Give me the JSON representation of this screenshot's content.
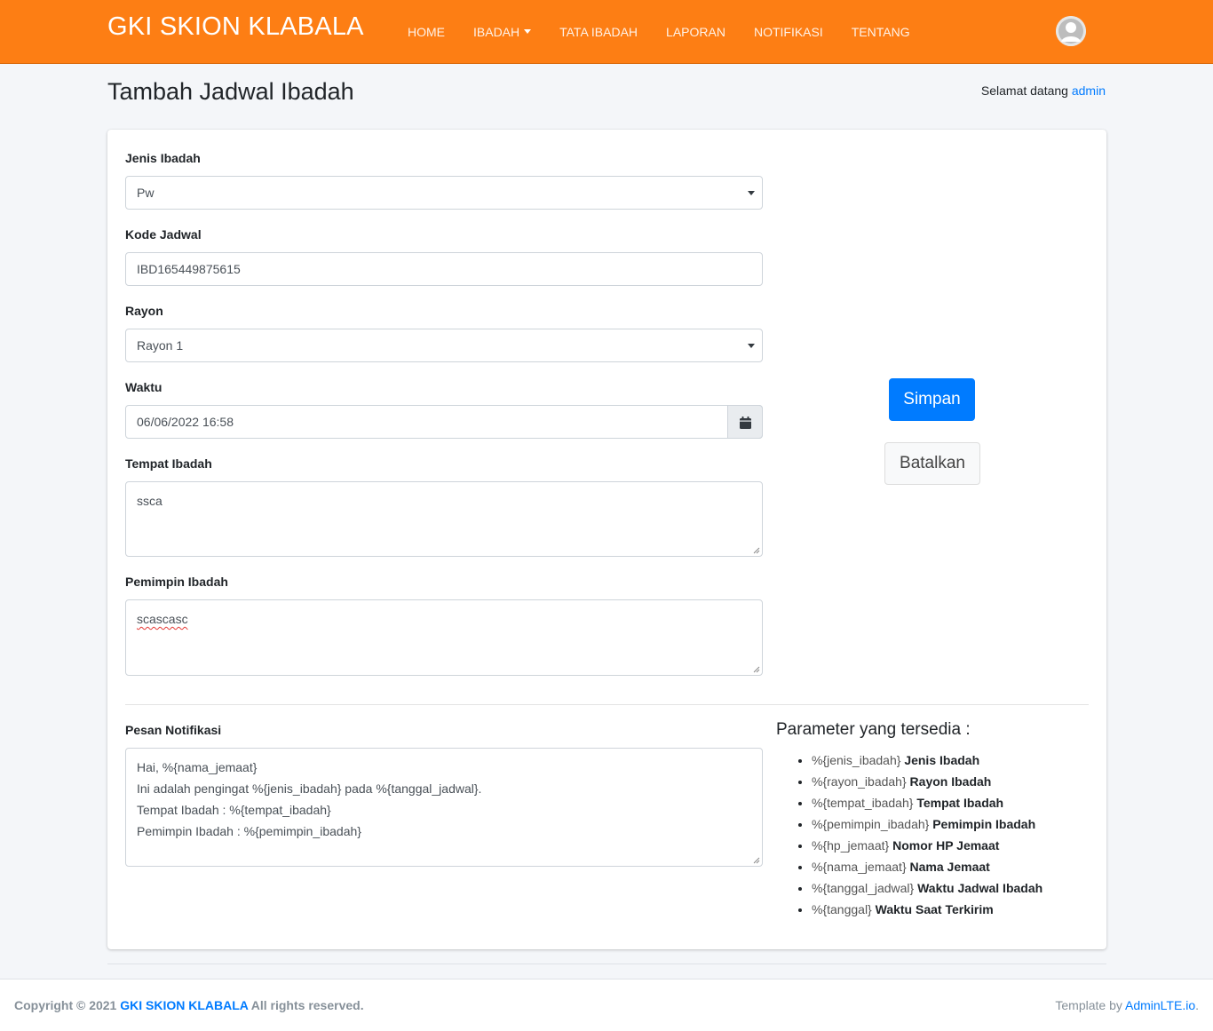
{
  "navbar": {
    "brand": "GKI SKION KLABALA",
    "items": [
      {
        "label": "HOME"
      },
      {
        "label": "IBADAH"
      },
      {
        "label": "TATA IBADAH"
      },
      {
        "label": "LAPORAN"
      },
      {
        "label": "NOTIFIKASI"
      },
      {
        "label": "TENTANG"
      }
    ],
    "avatar_icon": "user-avatar-icon"
  },
  "header": {
    "title": "Tambah Jadwal Ibadah",
    "welcome_prefix": "Selamat datang",
    "welcome_user": "admin"
  },
  "form": {
    "jenis_ibadah": {
      "label": "Jenis Ibadah",
      "value": "Pw"
    },
    "kode_jadwal": {
      "label": "Kode Jadwal",
      "value": "IBD165449875615"
    },
    "rayon": {
      "label": "Rayon",
      "value": "Rayon 1"
    },
    "waktu": {
      "label": "Waktu",
      "value": "06/06/2022 16:58",
      "icon": "calendar-icon"
    },
    "tempat_ibadah": {
      "label": "Tempat Ibadah",
      "value": "ssca"
    },
    "pemimpin_ibadah": {
      "label": "Pemimpin Ibadah",
      "value": "scascasc"
    },
    "pesan_notifikasi": {
      "label": "Pesan Notifikasi",
      "lines": [
        "Hai, %{nama_jemaat}",
        "Ini adalah pengingat %{jenis_ibadah} pada %{tanggal_jadwal}.",
        "Tempat Ibadah : %{tempat_ibadah}",
        "Pemimpin Ibadah : %{pemimpin_ibadah}"
      ]
    }
  },
  "actions": {
    "save_label": "Simpan",
    "cancel_label": "Batalkan"
  },
  "parameters": {
    "title": "Parameter yang tersedia :",
    "items": [
      {
        "code": "%{jenis_ibadah}",
        "desc": "Jenis Ibadah"
      },
      {
        "code": "%{rayon_ibadah}",
        "desc": "Rayon Ibadah"
      },
      {
        "code": "%{tempat_ibadah}",
        "desc": "Tempat Ibadah"
      },
      {
        "code": "%{pemimpin_ibadah}",
        "desc": "Pemimpin Ibadah"
      },
      {
        "code": "%{hp_jemaat}",
        "desc": "Nomor HP Jemaat"
      },
      {
        "code": "%{nama_jemaat}",
        "desc": "Nama Jemaat"
      },
      {
        "code": "%{tanggal_jadwal}",
        "desc": "Waktu Jadwal Ibadah"
      },
      {
        "code": "%{tanggal}",
        "desc": "Waktu Saat Terkirim"
      }
    ]
  },
  "footer": {
    "copyright_prefix": "Copyright © 2021",
    "copyright_brand": "GKI SKION KLABALA",
    "copyright_suffix": "All rights reserved.",
    "template_prefix": "Template by",
    "template_link": "AdminLTE.io",
    "template_suffix": "."
  },
  "colors": {
    "navbar": "#fd7e14",
    "primary": "#007bff",
    "background": "#f4f6f9"
  }
}
